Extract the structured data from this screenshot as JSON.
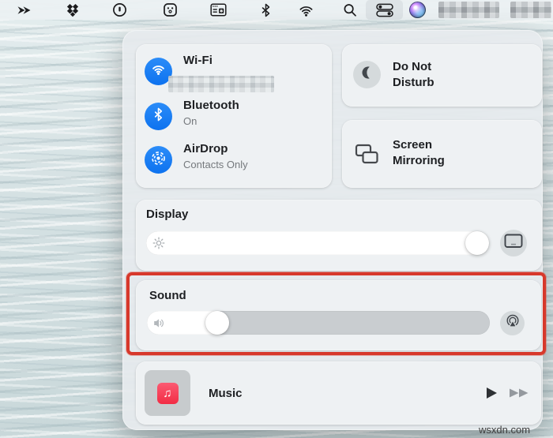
{
  "colors": {
    "accent_blue": "#147ef5",
    "highlight_red": "#d7382b",
    "music_red": "#f22c44"
  },
  "menu_bar": {
    "icons": [
      "arrows-app",
      "dropbox",
      "onepassword",
      "outlet-app",
      "window-app",
      "bluetooth",
      "wifi",
      "spotlight-search",
      "control-center",
      "siri"
    ],
    "clock_redacted": true
  },
  "control_center": {
    "wifi": {
      "title": "Wi-Fi",
      "network_redacted": true
    },
    "bluetooth": {
      "title": "Bluetooth",
      "status": "On"
    },
    "airdrop": {
      "title": "AirDrop",
      "status": "Contacts Only"
    },
    "do_not_disturb": {
      "title": "Do Not Disturb"
    },
    "screen_mirroring": {
      "title": "Screen Mirroring"
    },
    "display": {
      "title": "Display",
      "brightness_percent": 100
    },
    "sound": {
      "title": "Sound",
      "volume_percent": 24,
      "highlighted": true
    },
    "music": {
      "title": "Music"
    }
  },
  "watermark": "wsxdn.com"
}
